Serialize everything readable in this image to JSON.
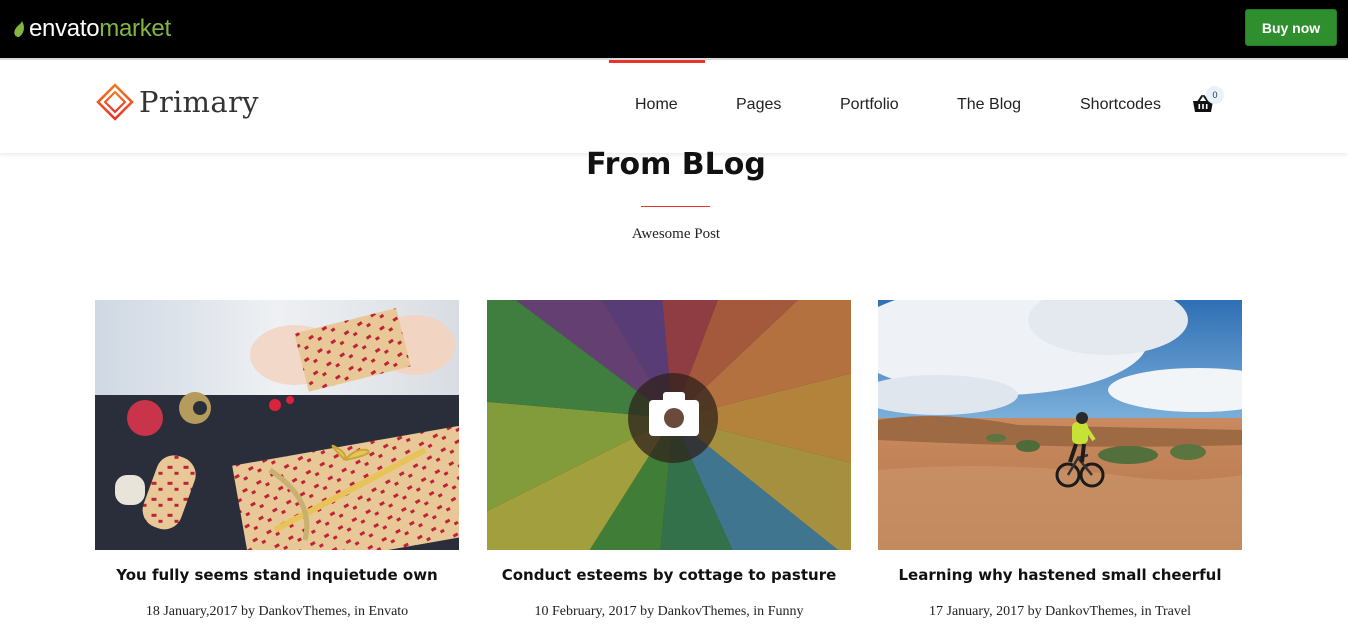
{
  "envato": {
    "brand_word": "envato",
    "brand_market": "market",
    "buy_label": "Buy now",
    "accent": "#82b541",
    "button_color": "#2f8f2f"
  },
  "site": {
    "brand_name": "Primary",
    "accent": "#e8342b",
    "nav": [
      "Home",
      "Pages",
      "Portfolio",
      "The Blog",
      "Shortcodes"
    ],
    "active_nav": "Home",
    "cart_count": "0",
    "cart_icon": "basket-icon"
  },
  "section": {
    "title": "From BLog",
    "subtitle": "Awesome Post"
  },
  "posts": [
    {
      "title": "You fully seems stand inquietude own",
      "date": "18 January,2017",
      "by": "by",
      "author": "DankovThemes,",
      "in": "in",
      "category": "Envato",
      "image": "gift-wrapping-photo"
    },
    {
      "title": "Conduct esteems by cottage to pasture",
      "date": "10 February, 2017",
      "by": "by",
      "author": "DankovThemes,",
      "in": "in",
      "category": "Funny",
      "image": "colored-pencils-photo",
      "overlay_icon": "camera-icon"
    },
    {
      "title": "Learning why hastened small cheerful",
      "date": "17 January, 2017",
      "by": "by",
      "author": "DankovThemes,",
      "in": "in",
      "category": "Travel",
      "image": "mountain-bike-desert-photo"
    }
  ]
}
